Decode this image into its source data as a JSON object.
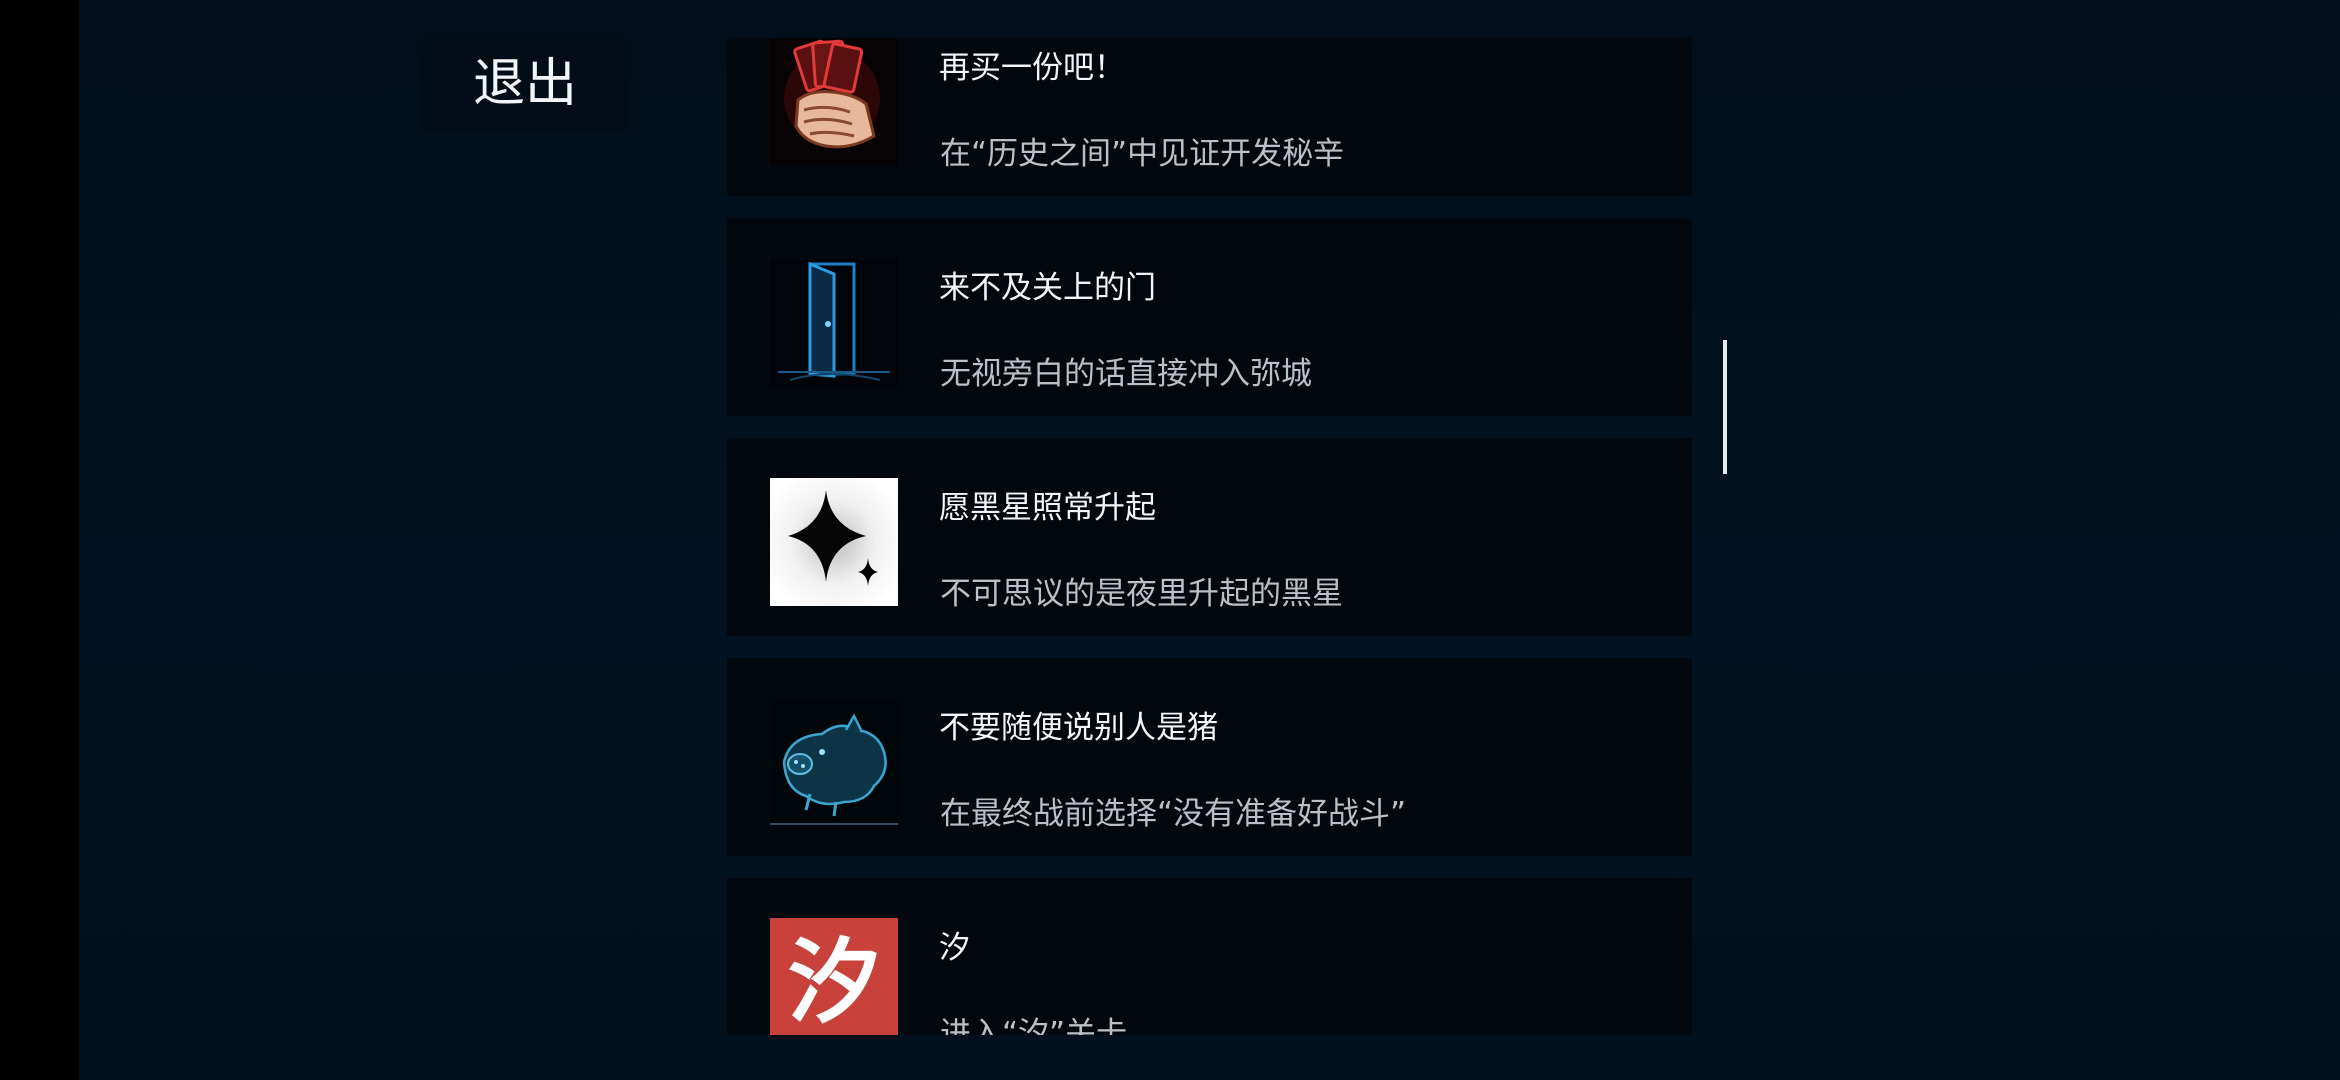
{
  "exit_label": "退出",
  "achievements": [
    {
      "title": "再买一份吧！",
      "description": "在“历史之间”中见证开发秘辛",
      "icon": "fist-with-cards-icon"
    },
    {
      "title": "来不及关上的门",
      "description": "无视旁白的话直接冲入弥城",
      "icon": "open-door-icon"
    },
    {
      "title": "愿黑星照常升起",
      "description": "不可思议的是夜里升起的黑星",
      "icon": "black-star-icon"
    },
    {
      "title": "不要随便说别人是猪",
      "description": "在最终战前选择“没有准备好战斗”",
      "icon": "pig-icon"
    },
    {
      "title": "汐",
      "description": "进入“汐”关卡",
      "icon": "xi-character-icon",
      "icon_text": "汐"
    }
  ]
}
